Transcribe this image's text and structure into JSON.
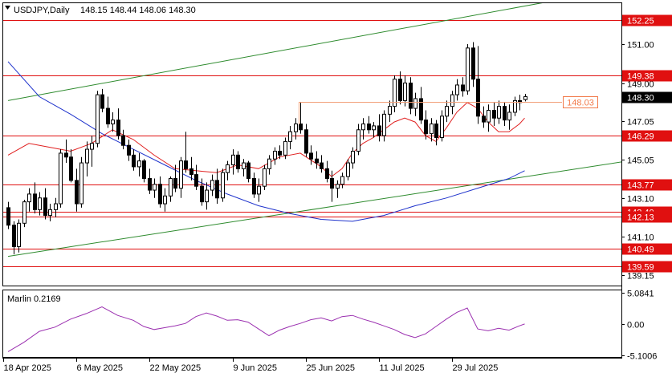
{
  "header": {
    "symbol_timeframe": "USDJPY,Daily",
    "ohlc": "148.15 148.44 148.06 148.30"
  },
  "indicator": {
    "label": "Marlin 0.2169",
    "scale_labels": [
      "5.0841",
      "0.00",
      "-5.1006"
    ],
    "scale_values": [
      5.0841,
      0,
      -5.1006
    ],
    "line_color": "#9b30b0"
  },
  "colors": {
    "candle": "#000000",
    "level": "#e01010",
    "channel": "#2e8b2e",
    "ma_slow": "#1f33cc",
    "ma_fast": "#e02020",
    "price_line": "#f2a07a",
    "price_label": "#f27a4a"
  },
  "levels": [
    {
      "value": 152.25,
      "label": "152.25"
    },
    {
      "value": 149.38,
      "label": "149.38"
    },
    {
      "value": 146.29,
      "label": "146.29"
    },
    {
      "value": 143.77,
      "label": "143.77"
    },
    {
      "value": 142.4,
      "label": "142.40"
    },
    {
      "value": 142.13,
      "label": "142.13"
    },
    {
      "value": 140.49,
      "label": "140.49"
    },
    {
      "value": 139.59,
      "label": "139.59"
    }
  ],
  "price_axis": [
    {
      "value": 151.0,
      "label": "151.00"
    },
    {
      "value": 149.0,
      "label": "149.00"
    },
    {
      "value": 147.05,
      "label": "147.05"
    },
    {
      "value": 145.05,
      "label": "145.05"
    },
    {
      "value": 143.1,
      "label": "143.10"
    },
    {
      "value": 141.1,
      "label": "141.10"
    },
    {
      "value": 139.15,
      "label": "139.15"
    }
  ],
  "current_price": {
    "value": 148.3,
    "label": "148.30"
  },
  "marked_price": {
    "value": 148.03,
    "label": "148.03"
  },
  "time_axis": [
    "18 Apr 2025",
    "6 May 2025",
    "22 May 2025",
    "9 Jun 2025",
    "25 Jun 2025",
    "11 Jul 2025",
    "29 Jul 2025"
  ],
  "chart_data": {
    "type": "candlestick",
    "ylim": [
      138.6,
      153.1
    ],
    "xlabel": "",
    "ylabel": "",
    "candles": [
      [
        142.6,
        142.9,
        141.5,
        141.7
      ],
      [
        141.7,
        141.9,
        140.2,
        140.6
      ],
      [
        140.6,
        142.0,
        140.3,
        141.8
      ],
      [
        141.8,
        143.0,
        141.6,
        142.9
      ],
      [
        142.9,
        143.6,
        142.4,
        143.3
      ],
      [
        143.3,
        143.9,
        142.3,
        142.5
      ],
      [
        142.5,
        143.4,
        142.2,
        143.1
      ],
      [
        143.1,
        143.6,
        142.0,
        142.2
      ],
      [
        142.2,
        142.8,
        141.9,
        142.5
      ],
      [
        142.5,
        143.1,
        142.1,
        142.8
      ],
      [
        142.8,
        145.6,
        142.6,
        145.4
      ],
      [
        145.4,
        146.1,
        144.9,
        145.2
      ],
      [
        145.2,
        145.6,
        143.9,
        144.0
      ],
      [
        144.0,
        144.6,
        142.4,
        142.8
      ],
      [
        142.8,
        145.2,
        142.6,
        144.9
      ],
      [
        144.9,
        146.0,
        144.2,
        145.6
      ],
      [
        145.6,
        146.3,
        144.7,
        145.9
      ],
      [
        145.9,
        148.6,
        145.7,
        148.4
      ],
      [
        148.4,
        148.7,
        147.5,
        147.7
      ],
      [
        147.7,
        148.3,
        146.7,
        146.9
      ],
      [
        146.9,
        147.5,
        146.5,
        147.1
      ],
      [
        147.1,
        147.7,
        146.1,
        146.3
      ],
      [
        146.3,
        146.6,
        145.6,
        145.8
      ],
      [
        145.8,
        146.1,
        145.0,
        145.3
      ],
      [
        145.3,
        145.6,
        144.5,
        144.7
      ],
      [
        144.7,
        145.4,
        144.2,
        145.0
      ],
      [
        145.0,
        145.1,
        143.9,
        144.1
      ],
      [
        144.1,
        144.6,
        143.3,
        143.5
      ],
      [
        143.5,
        144.1,
        143.1,
        143.8
      ],
      [
        143.8,
        144.2,
        142.6,
        142.8
      ],
      [
        142.8,
        143.6,
        142.4,
        143.2
      ],
      [
        143.2,
        144.2,
        142.9,
        144.1
      ],
      [
        144.1,
        144.8,
        143.4,
        143.6
      ],
      [
        143.6,
        145.2,
        143.1,
        145.0
      ],
      [
        145.0,
        146.5,
        144.4,
        144.6
      ],
      [
        144.6,
        145.2,
        144.0,
        144.3
      ],
      [
        144.3,
        144.8,
        143.5,
        143.7
      ],
      [
        143.7,
        144.1,
        142.7,
        142.9
      ],
      [
        142.9,
        143.9,
        142.5,
        143.5
      ],
      [
        143.5,
        144.3,
        143.2,
        144.0
      ],
      [
        144.0,
        144.6,
        142.8,
        143.1
      ],
      [
        143.1,
        144.6,
        142.9,
        144.4
      ],
      [
        144.4,
        145.0,
        144.0,
        144.8
      ],
      [
        144.8,
        145.6,
        144.3,
        145.3
      ],
      [
        145.3,
        145.5,
        144.4,
        144.6
      ],
      [
        144.6,
        145.1,
        144.2,
        144.9
      ],
      [
        144.9,
        145.0,
        143.9,
        144.1
      ],
      [
        144.1,
        144.4,
        143.1,
        143.3
      ],
      [
        143.3,
        144.1,
        142.9,
        143.7
      ],
      [
        143.7,
        144.8,
        143.5,
        144.6
      ],
      [
        144.6,
        145.3,
        144.3,
        145.1
      ],
      [
        145.1,
        145.7,
        144.8,
        145.5
      ],
      [
        145.5,
        145.8,
        145.1,
        145.3
      ],
      [
        145.3,
        146.2,
        145.1,
        146.0
      ],
      [
        146.0,
        146.8,
        145.6,
        146.5
      ],
      [
        146.5,
        147.2,
        146.1,
        146.9
      ],
      [
        146.9,
        148.0,
        146.4,
        146.6
      ],
      [
        146.6,
        146.9,
        145.2,
        145.4
      ],
      [
        145.4,
        145.8,
        144.8,
        145.1
      ],
      [
        145.1,
        145.5,
        144.6,
        144.9
      ],
      [
        144.9,
        145.3,
        144.4,
        144.6
      ],
      [
        144.6,
        145.0,
        143.9,
        144.1
      ],
      [
        144.1,
        144.5,
        142.9,
        143.6
      ],
      [
        143.6,
        144.0,
        143.1,
        143.8
      ],
      [
        143.8,
        144.4,
        143.6,
        144.2
      ],
      [
        144.2,
        145.1,
        144.0,
        144.9
      ],
      [
        144.9,
        145.7,
        144.6,
        145.5
      ],
      [
        145.5,
        146.9,
        145.3,
        146.6
      ],
      [
        146.6,
        147.2,
        146.1,
        146.9
      ],
      [
        146.9,
        147.3,
        146.4,
        146.6
      ],
      [
        146.6,
        147.0,
        146.2,
        146.8
      ],
      [
        146.8,
        147.4,
        146.0,
        146.3
      ],
      [
        146.3,
        147.6,
        146.0,
        147.4
      ],
      [
        147.4,
        148.1,
        147.0,
        147.8
      ],
      [
        147.8,
        149.4,
        147.5,
        149.2
      ],
      [
        149.2,
        149.6,
        147.9,
        148.1
      ],
      [
        148.1,
        149.4,
        147.8,
        149.0
      ],
      [
        149.0,
        149.3,
        147.4,
        147.7
      ],
      [
        147.7,
        148.5,
        147.3,
        148.2
      ],
      [
        148.2,
        148.8,
        146.9,
        147.1
      ],
      [
        147.1,
        147.6,
        146.1,
        146.4
      ],
      [
        146.4,
        147.2,
        146.0,
        146.9
      ],
      [
        146.9,
        147.1,
        145.8,
        146.2
      ],
      [
        146.2,
        147.6,
        146.0,
        147.3
      ],
      [
        147.3,
        148.1,
        147.0,
        147.8
      ],
      [
        147.8,
        148.6,
        147.4,
        148.4
      ],
      [
        148.4,
        149.2,
        148.1,
        148.9
      ],
      [
        148.9,
        149.3,
        148.3,
        148.6
      ],
      [
        148.6,
        151.0,
        148.4,
        150.8
      ],
      [
        150.8,
        151.1,
        148.8,
        149.2
      ],
      [
        149.2,
        150.9,
        146.9,
        147.3
      ],
      [
        147.3,
        147.8,
        146.7,
        147.0
      ],
      [
        147.0,
        147.9,
        146.5,
        147.6
      ],
      [
        147.6,
        148.0,
        146.8,
        147.2
      ],
      [
        147.2,
        148.1,
        146.9,
        147.8
      ],
      [
        147.8,
        148.0,
        146.8,
        147.1
      ],
      [
        147.1,
        147.9,
        146.6,
        147.5
      ],
      [
        147.5,
        148.3,
        147.3,
        148.1
      ],
      [
        148.1,
        148.4,
        147.6,
        148.0
      ],
      [
        148.15,
        148.44,
        148.06,
        148.3
      ]
    ],
    "ma_fast": [
      [
        0,
        145.3
      ],
      [
        4,
        145.9
      ],
      [
        8,
        145.7
      ],
      [
        12,
        145.5
      ],
      [
        16,
        145.9
      ],
      [
        20,
        146.6
      ],
      [
        24,
        146.1
      ],
      [
        28,
        145.3
      ],
      [
        32,
        144.6
      ],
      [
        36,
        144.5
      ],
      [
        40,
        144.4
      ],
      [
        44,
        144.8
      ],
      [
        48,
        144.6
      ],
      [
        52,
        145.2
      ],
      [
        56,
        145.4
      ],
      [
        60,
        144.7
      ],
      [
        62,
        144.2
      ],
      [
        64,
        144.6
      ],
      [
        66,
        145.4
      ],
      [
        68,
        145.9
      ],
      [
        70,
        146.2
      ],
      [
        72,
        146.6
      ],
      [
        74,
        147.0
      ],
      [
        76,
        147.2
      ],
      [
        78,
        147.0
      ],
      [
        80,
        146.3
      ],
      [
        82,
        146.0
      ],
      [
        84,
        146.7
      ],
      [
        86,
        147.5
      ],
      [
        88,
        148.0
      ],
      [
        90,
        147.7
      ],
      [
        92,
        147.0
      ],
      [
        94,
        146.5
      ],
      [
        96,
        146.5
      ],
      [
        98,
        146.9
      ],
      [
        99,
        147.2
      ]
    ],
    "ma_slow": [
      [
        0,
        150.1
      ],
      [
        6,
        148.3
      ],
      [
        12,
        147.4
      ],
      [
        18,
        146.4
      ],
      [
        24,
        145.6
      ],
      [
        30,
        144.8
      ],
      [
        36,
        144.0
      ],
      [
        42,
        143.3
      ],
      [
        48,
        142.7
      ],
      [
        54,
        142.3
      ],
      [
        60,
        142.0
      ],
      [
        66,
        141.9
      ],
      [
        72,
        142.2
      ],
      [
        78,
        142.7
      ],
      [
        84,
        143.1
      ],
      [
        90,
        143.6
      ],
      [
        96,
        144.1
      ],
      [
        99,
        144.5
      ]
    ],
    "channel_upper": [
      [
        0,
        148.1
      ],
      [
        104,
        153.2
      ]
    ],
    "channel_lower_1": [
      [
        0,
        140.1
      ],
      [
        126,
        145.3
      ]
    ],
    "channel_lower_2": [
      [
        55,
        142.7
      ],
      [
        126,
        145.3
      ]
    ],
    "marlin": [
      [
        0,
        -4.5
      ],
      [
        3,
        -3.0
      ],
      [
        6,
        -1.2
      ],
      [
        9,
        -0.5
      ],
      [
        12,
        0.8
      ],
      [
        15,
        1.7
      ],
      [
        18,
        2.8
      ],
      [
        21,
        1.4
      ],
      [
        24,
        0.6
      ],
      [
        26,
        -0.4
      ],
      [
        28,
        -0.9
      ],
      [
        30,
        -0.6
      ],
      [
        32,
        -0.3
      ],
      [
        34,
        0.1
      ],
      [
        36,
        1.2
      ],
      [
        38,
        1.8
      ],
      [
        40,
        1.3
      ],
      [
        42,
        0.6
      ],
      [
        44,
        0.7
      ],
      [
        46,
        0.3
      ],
      [
        48,
        -0.8
      ],
      [
        50,
        -1.9
      ],
      [
        52,
        -1.0
      ],
      [
        54,
        -0.4
      ],
      [
        56,
        0.1
      ],
      [
        58,
        0.7
      ],
      [
        60,
        1.0
      ],
      [
        62,
        0.5
      ],
      [
        64,
        1.2
      ],
      [
        66,
        1.4
      ],
      [
        68,
        0.8
      ],
      [
        70,
        0.3
      ],
      [
        72,
        -0.3
      ],
      [
        74,
        -0.9
      ],
      [
        76,
        -1.7
      ],
      [
        78,
        -2.2
      ],
      [
        80,
        -1.6
      ],
      [
        82,
        -0.4
      ],
      [
        84,
        0.8
      ],
      [
        86,
        1.9
      ],
      [
        88,
        2.6
      ],
      [
        90,
        -0.8
      ],
      [
        92,
        -1.1
      ],
      [
        94,
        -0.7
      ],
      [
        96,
        -1.0
      ],
      [
        98,
        -0.3
      ],
      [
        99,
        0.0
      ]
    ]
  }
}
